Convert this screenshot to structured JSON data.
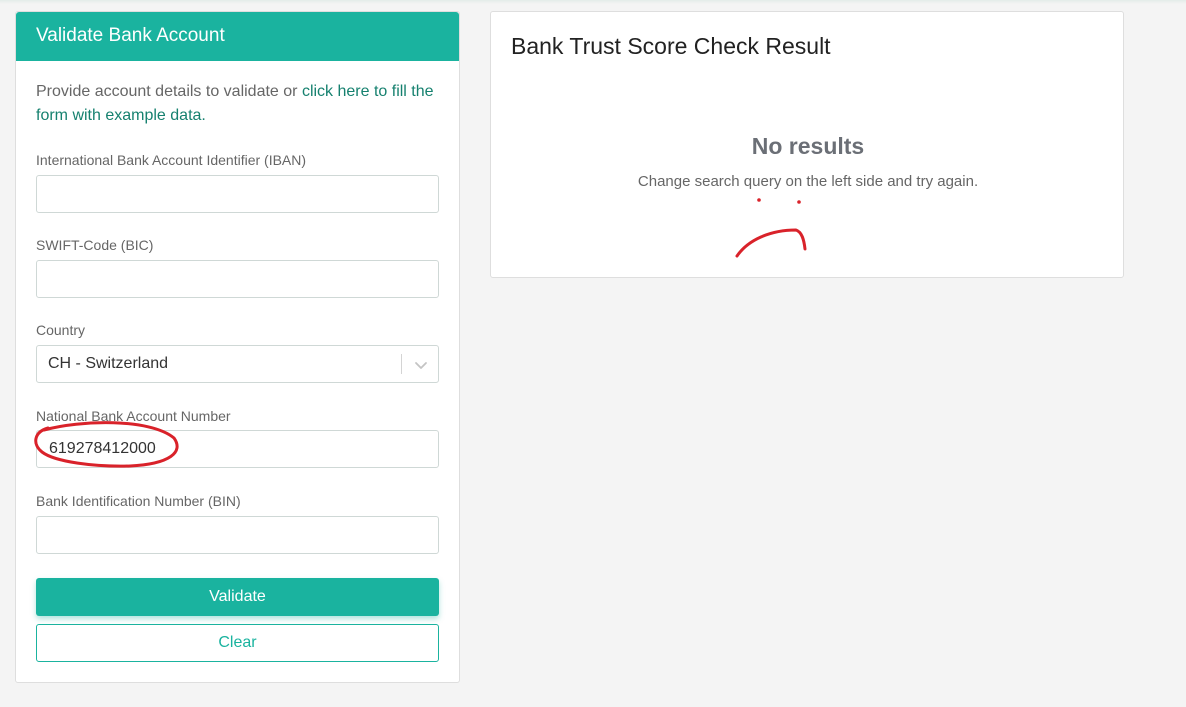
{
  "validate_panel": {
    "title": "Validate Bank Account",
    "intro_text": "Provide account details to validate or ",
    "intro_link": "click here to fill the form with example data.",
    "fields": {
      "iban": {
        "label": "International Bank Account Identifier (IBAN)",
        "value": ""
      },
      "bic": {
        "label": "SWIFT-Code (BIC)",
        "value": ""
      },
      "country": {
        "label": "Country",
        "value": "CH - Switzerland"
      },
      "national_account": {
        "label": "National Bank Account Number",
        "value": "619278412000"
      },
      "bin": {
        "label": "Bank Identification Number (BIN)",
        "value": ""
      }
    },
    "validate_label": "Validate",
    "clear_label": "Clear"
  },
  "result_panel": {
    "title": "Bank Trust Score Check Result",
    "empty_title": "No results",
    "empty_hint": "Change search query on the left side and try again."
  },
  "colors": {
    "accent": "#1ab39f",
    "link": "#16816f",
    "annotation": "#d9222a"
  },
  "icons": {
    "country_dropdown": "chevron-down-icon"
  }
}
